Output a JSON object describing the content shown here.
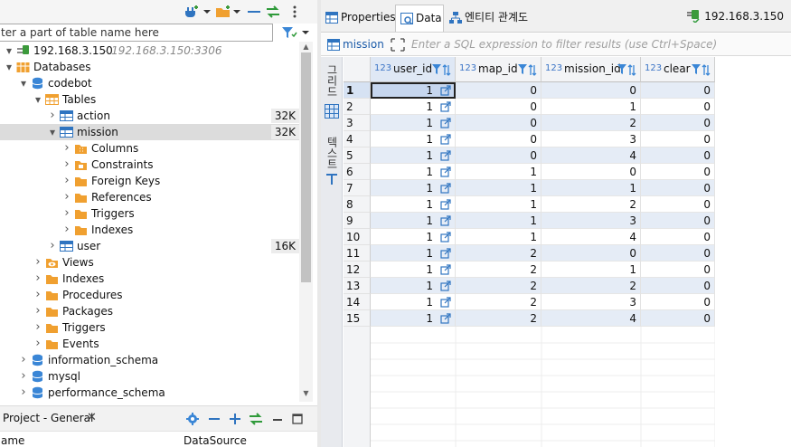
{
  "colors": {
    "accent": "#2f74c0",
    "folder": "#f0a030",
    "db": "#3a86d6",
    "selected_row": "#dcdcdc",
    "stripe": "#e5ecf6"
  },
  "nav_toolbar": {
    "icons": [
      "plug-add-icon",
      "chevron-down-icon",
      "folder-add-icon",
      "chevron-down-icon",
      "collapse-icon",
      "link-icon",
      "menu-icon"
    ]
  },
  "nav_filter": {
    "value": "ter a part of table name here"
  },
  "tree": [
    {
      "id": "conn",
      "label": "192.168.3.150",
      "sub": " - 192.168.3.150:3306",
      "icon": "connection-icon",
      "level": 0,
      "expanded": true
    },
    {
      "id": "databases",
      "label": "Databases",
      "icon": "databases-icon",
      "level": 0,
      "expanded": true
    },
    {
      "id": "codebot",
      "label": "codebot",
      "icon": "database-icon",
      "level": 1,
      "expanded": true
    },
    {
      "id": "tables",
      "label": "Tables",
      "icon": "tables-folder-icon",
      "level": 2,
      "expanded": true
    },
    {
      "id": "action",
      "label": "action",
      "icon": "table-icon",
      "level": 3,
      "expanded": false,
      "count": "32K"
    },
    {
      "id": "mission",
      "label": "mission",
      "icon": "table-icon",
      "level": 3,
      "expanded": true,
      "count": "32K",
      "selected": true
    },
    {
      "id": "columns",
      "label": "Columns",
      "icon": "columns-icon",
      "level": 4,
      "expanded": false
    },
    {
      "id": "constraints",
      "label": "Constraints",
      "icon": "constraints-icon",
      "level": 4,
      "expanded": false
    },
    {
      "id": "fks",
      "label": "Foreign Keys",
      "icon": "folder-icon",
      "level": 4,
      "expanded": false
    },
    {
      "id": "refs",
      "label": "References",
      "icon": "folder-icon",
      "level": 4,
      "expanded": false
    },
    {
      "id": "triggers1",
      "label": "Triggers",
      "icon": "folder-icon",
      "level": 4,
      "expanded": false
    },
    {
      "id": "indexes1",
      "label": "Indexes",
      "icon": "folder-icon",
      "level": 4,
      "expanded": false
    },
    {
      "id": "user",
      "label": "user",
      "icon": "table-icon",
      "level": 3,
      "expanded": false,
      "count": "16K"
    },
    {
      "id": "views",
      "label": "Views",
      "icon": "views-icon",
      "level": 2,
      "expanded": false
    },
    {
      "id": "indexes2",
      "label": "Indexes",
      "icon": "folder-icon",
      "level": 2,
      "expanded": false
    },
    {
      "id": "procedures",
      "label": "Procedures",
      "icon": "folder-icon",
      "level": 2,
      "expanded": false
    },
    {
      "id": "packages",
      "label": "Packages",
      "icon": "folder-icon",
      "level": 2,
      "expanded": false
    },
    {
      "id": "triggers2",
      "label": "Triggers",
      "icon": "folder-icon",
      "level": 2,
      "expanded": false
    },
    {
      "id": "events",
      "label": "Events",
      "icon": "folder-icon",
      "level": 2,
      "expanded": false
    },
    {
      "id": "infoschema",
      "label": "information_schema",
      "icon": "database-icon",
      "level": 1,
      "expanded": false
    },
    {
      "id": "mysql",
      "label": "mysql",
      "icon": "database-icon",
      "level": 1,
      "expanded": false
    },
    {
      "id": "perfschema",
      "label": "performance_schema",
      "icon": "database-icon",
      "level": 1,
      "expanded": false
    }
  ],
  "project_panel": {
    "tab_label": "Project - General",
    "close": "✕",
    "col_name": "ame",
    "col_datasource": "DataSource"
  },
  "editor": {
    "tabs": [
      {
        "label": "Properties",
        "icon": "properties-icon"
      },
      {
        "label": "Data",
        "icon": "data-icon",
        "active": true
      },
      {
        "label": "엔티티 관계도",
        "icon": "er-diagram-icon"
      }
    ],
    "connection": "192.168.3.150",
    "table_name": "mission",
    "filter_placeholder": "Enter a SQL expression to filter results (use Ctrl+Space)",
    "side_tabs": [
      "그리드",
      "텍스트"
    ]
  },
  "grid": {
    "type_prefix": "123",
    "columns": [
      "user_id",
      "map_id",
      "mission_id",
      "clear"
    ],
    "rows": [
      [
        "1",
        "1",
        "0",
        "0",
        "0"
      ],
      [
        "2",
        "1",
        "0",
        "1",
        "0"
      ],
      [
        "3",
        "1",
        "0",
        "2",
        "0"
      ],
      [
        "4",
        "1",
        "0",
        "3",
        "0"
      ],
      [
        "5",
        "1",
        "0",
        "4",
        "0"
      ],
      [
        "6",
        "1",
        "1",
        "0",
        "0"
      ],
      [
        "7",
        "1",
        "1",
        "1",
        "0"
      ],
      [
        "8",
        "1",
        "1",
        "2",
        "0"
      ],
      [
        "9",
        "1",
        "1",
        "3",
        "0"
      ],
      [
        "10",
        "1",
        "1",
        "4",
        "0"
      ],
      [
        "11",
        "1",
        "2",
        "0",
        "0"
      ],
      [
        "12",
        "1",
        "2",
        "1",
        "0"
      ],
      [
        "13",
        "1",
        "2",
        "2",
        "0"
      ],
      [
        "14",
        "1",
        "2",
        "3",
        "0"
      ],
      [
        "15",
        "1",
        "2",
        "4",
        "0"
      ]
    ],
    "selected_row": 1
  }
}
